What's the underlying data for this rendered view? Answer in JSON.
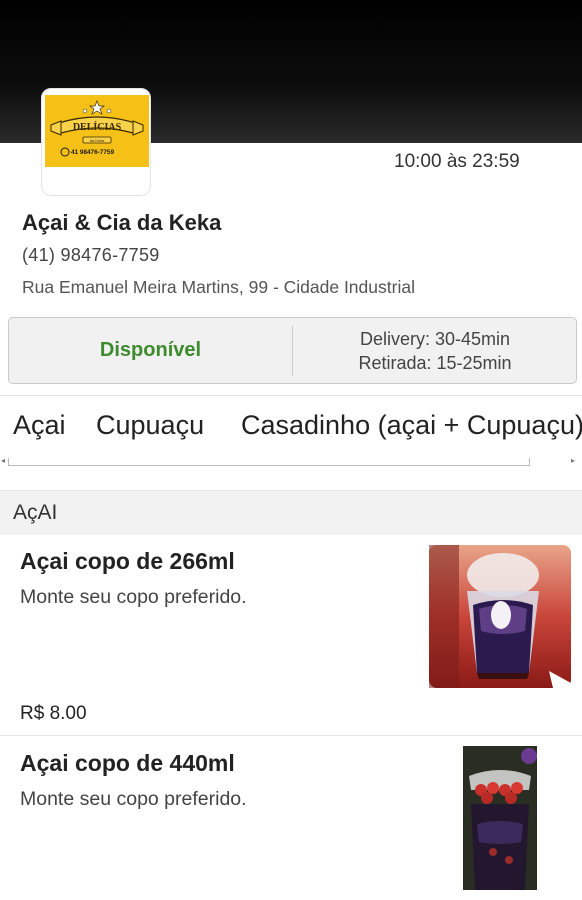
{
  "store": {
    "logo_text": "DELÍCIAS",
    "logo_subtext": "da Keka",
    "logo_phone": "41 98476-7759",
    "hours": "10:00 às 23:59",
    "name": "Açai & Cia da Keka",
    "phone": "(41) 98476-7759",
    "address": "Rua Emanuel Meira Martins, 99 - Cidade Industrial"
  },
  "status": {
    "availability": "Disponível",
    "delivery_time": "Delivery: 30-45min",
    "pickup_time": "Retirada: 15-25min",
    "availability_color": "#3d8b2e"
  },
  "categories": {
    "items": [
      "Açai",
      "Cupuaçu",
      "Casadinho (açai + Cupuaçu)"
    ]
  },
  "section": {
    "title": "AçAI"
  },
  "products": [
    {
      "name": "Açai copo de 266ml",
      "description": "Monte seu copo preferido.",
      "price": "R$ 8.00"
    },
    {
      "name": "Açai copo de 440ml",
      "description": "Monte seu copo preferido."
    }
  ],
  "colors": {
    "header_bg": "#000000",
    "logo_bg": "#f5c116",
    "accent_green": "#3d8b2e"
  }
}
